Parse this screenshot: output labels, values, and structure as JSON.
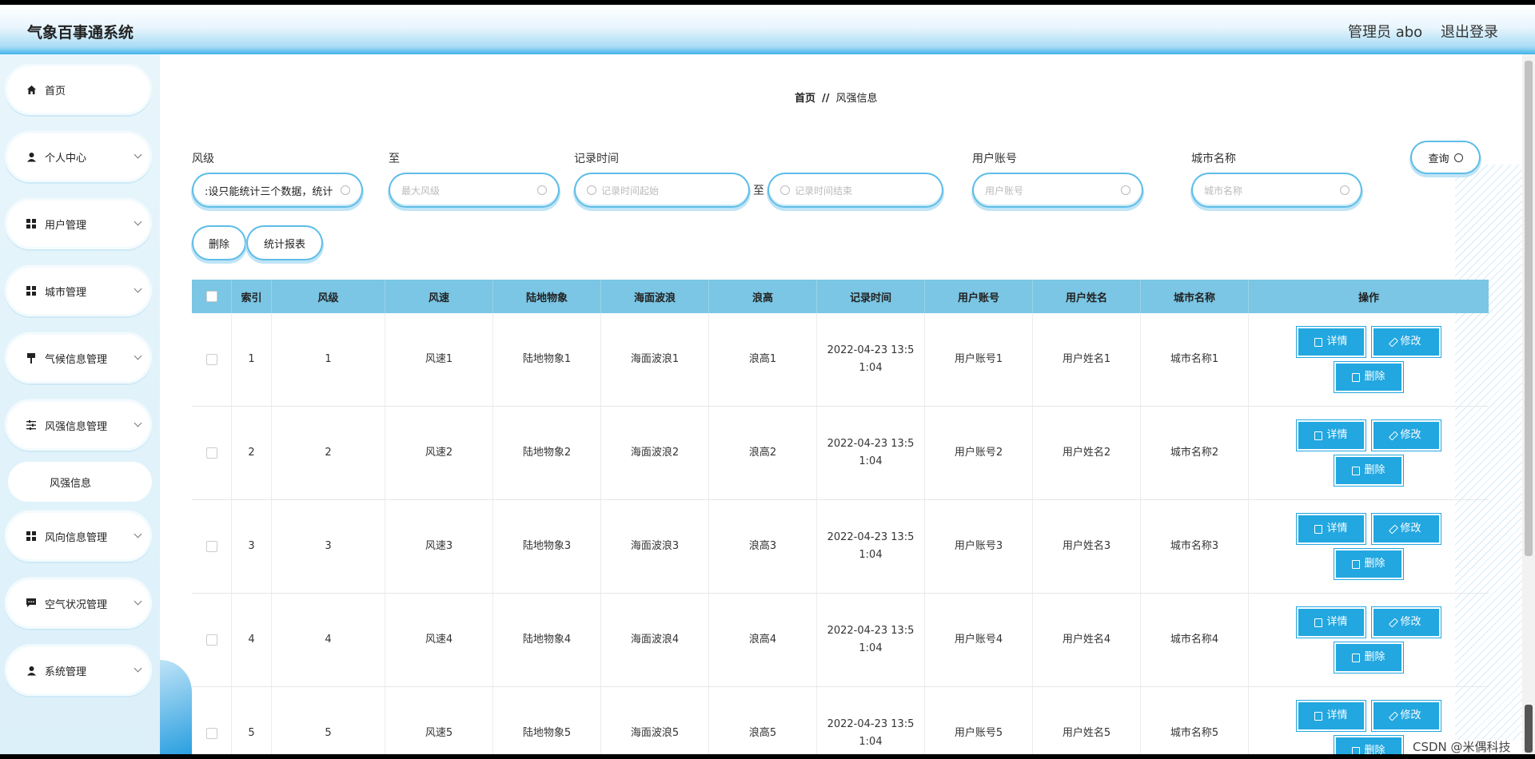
{
  "header": {
    "title": "气象百事通系统",
    "admin": "管理员 abo",
    "logout": "退出登录"
  },
  "sidebar": {
    "items": [
      {
        "label": "首页",
        "icon": "home-icon"
      },
      {
        "label": "个人中心",
        "icon": "user-icon"
      },
      {
        "label": "用户管理",
        "icon": "grid-icon"
      },
      {
        "label": "城市管理",
        "icon": "grid-icon"
      },
      {
        "label": "气候信息管理",
        "icon": "brush-icon"
      },
      {
        "label": "风强信息管理",
        "icon": "sliders-icon"
      },
      {
        "label": "风向信息管理",
        "icon": "grid-icon"
      },
      {
        "label": "空气状况管理",
        "icon": "message-icon"
      },
      {
        "label": "系统管理",
        "icon": "user-icon"
      }
    ],
    "sub_item": "风强信息"
  },
  "breadcrumb": {
    "home": "首页",
    "separator": "//",
    "current": "风强信息"
  },
  "filters": {
    "wind_level_label": "风级",
    "wind_level_value": ":设只能统计三个数据，统计",
    "to_label": "至",
    "max_level_placeholder": "最大风级",
    "record_time_label": "记录时间",
    "time_start_placeholder": "记录时间起始",
    "time_to": "至",
    "time_end_placeholder": "记录时间结束",
    "user_account_label": "用户账号",
    "user_account_placeholder": "用户账号",
    "city_label": "城市名称",
    "city_placeholder": "城市名称",
    "query_button": "查询"
  },
  "actions": {
    "delete": "删除",
    "report": "统计报表"
  },
  "table": {
    "columns": [
      "索引",
      "风级",
      "风速",
      "陆地物象",
      "海面波浪",
      "浪高",
      "记录时间",
      "用户账号",
      "用户姓名",
      "城市名称",
      "操作"
    ],
    "rows": [
      [
        "1",
        "1",
        "风速1",
        "陆地物象1",
        "海面波浪1",
        "浪高1",
        "2022-04-23 13:51:04",
        "用户账号1",
        "用户姓名1",
        "城市名称1"
      ],
      [
        "2",
        "2",
        "风速2",
        "陆地物象2",
        "海面波浪2",
        "浪高2",
        "2022-04-23 13:51:04",
        "用户账号2",
        "用户姓名2",
        "城市名称2"
      ],
      [
        "3",
        "3",
        "风速3",
        "陆地物象3",
        "海面波浪3",
        "浪高3",
        "2022-04-23 13:51:04",
        "用户账号3",
        "用户姓名3",
        "城市名称3"
      ],
      [
        "4",
        "4",
        "风速4",
        "陆地物象4",
        "海面波浪4",
        "浪高4",
        "2022-04-23 13:51:04",
        "用户账号4",
        "用户姓名4",
        "城市名称4"
      ],
      [
        "5",
        "5",
        "风速5",
        "陆地物象5",
        "海面波浪5",
        "浪高5",
        "2022-04-23 13:51:04",
        "用户账号5",
        "用户姓名5",
        "城市名称5"
      ]
    ],
    "op_detail": "详情",
    "op_edit": "修改",
    "op_delete": "删除"
  },
  "watermark": "CSDN @米偶科技"
}
